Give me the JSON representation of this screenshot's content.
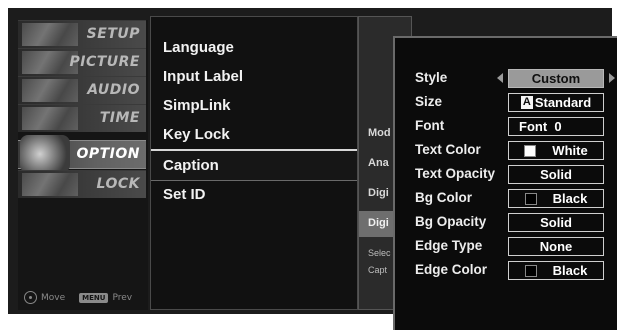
{
  "sidebar": {
    "categories": [
      "SETUP",
      "PICTURE",
      "AUDIO",
      "TIME",
      "OPTION",
      "LOCK"
    ],
    "selected": "OPTION",
    "footer": {
      "move_label": "Move",
      "menu_key": "MENU",
      "prev_label": "Prev"
    }
  },
  "options": {
    "items": [
      "Language",
      "Input Label",
      "SimpLink",
      "Key Lock",
      "Caption",
      "Set ID"
    ],
    "selected": "Caption"
  },
  "caption_modes": {
    "items": [
      "Mod",
      "Ana",
      "Digi",
      "Digi"
    ],
    "selected_index": 3,
    "help": [
      "Selec",
      "Capt"
    ]
  },
  "custom_panel": {
    "rows": [
      {
        "label": "Style",
        "value": "Custom"
      },
      {
        "label": "Size",
        "value": "Standard",
        "glyph": "A"
      },
      {
        "label": "Font",
        "value": "Font  0"
      },
      {
        "label": "Text Color",
        "value": "White",
        "swatch": "#ffffff"
      },
      {
        "label": "Text Opacity",
        "value": "Solid"
      },
      {
        "label": "Bg Color",
        "value": "Black",
        "swatch": "#000000"
      },
      {
        "label": "Bg Opacity",
        "value": "Solid"
      },
      {
        "label": "Edge Type",
        "value": "None"
      },
      {
        "label": "Edge Color",
        "value": "Black",
        "swatch": "#000000"
      }
    ]
  },
  "colors": {
    "background": "#1c1c1c",
    "highlight": "#9a9a9a",
    "text": "#ededed"
  }
}
